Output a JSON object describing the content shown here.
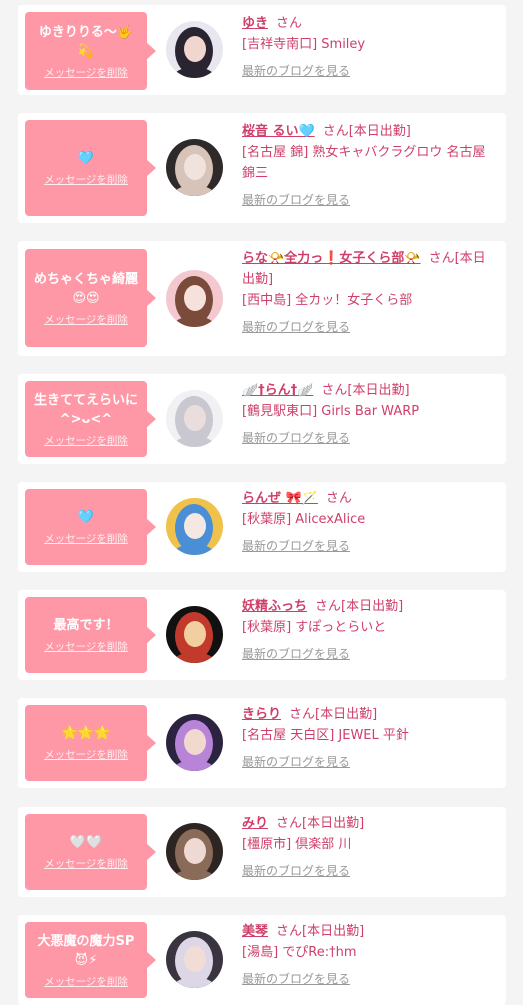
{
  "delete_label": "メッセージを削除",
  "blog_label": "最新のブログを見る",
  "san_label": "さん",
  "colors": {
    "bubble": "#ff98a6",
    "name": "#cf3f6a",
    "link_gray": "#999999",
    "background": "#f4f4f4"
  },
  "cards": [
    {
      "message": "ゆきりりる〜🤟\n💫",
      "name": "ゆき",
      "status": "",
      "shop": "[吉祥寺南口] Smiley",
      "avatar_colors": [
        "#e8e6ef",
        "#2a2430",
        "#f1d6cf"
      ]
    },
    {
      "message": "🩵",
      "name": "桜音 るい🩵",
      "status": "[本日出勤]",
      "shop": "[名古屋 錦] 熟女キャバクラグロウ 名古屋錦三",
      "avatar_colors": [
        "#2e2a2a",
        "#d8c3b8",
        "#f0e2dc"
      ]
    },
    {
      "message": "めちゃくちゃ綺麗\n😍😍",
      "name": "らな📯全力っ❗️女子くら部📯",
      "status": "[本日出勤]",
      "shop": "[西中島] 全カッ！女子くら部",
      "avatar_colors": [
        "#f3c9cf",
        "#7a4b3a",
        "#f7e1dc"
      ]
    },
    {
      "message": "生きててえらいに\n^>ᴗ<^",
      "name": "🪽†らん†🪽",
      "status": "[本日出勤]",
      "shop": "[鶴見駅東口] Girls Bar WARP",
      "avatar_colors": [
        "#f1f1f3",
        "#c9c7cf",
        "#e9dedd"
      ]
    },
    {
      "message": "🩵",
      "name": "らんぜ 🎀🪄",
      "status": "",
      "shop": "[秋葉原] AlicexAlice",
      "avatar_colors": [
        "#f0c14b",
        "#4a8fd6",
        "#f5e7e1"
      ]
    },
    {
      "message": "最高です！",
      "name": "妖精ふっち",
      "status": "[本日出勤]",
      "shop": "[秋葉原] すぽっとらいと",
      "avatar_colors": [
        "#111111",
        "#c23a2b",
        "#f2cfa0"
      ]
    },
    {
      "message": "🌟🌟🌟",
      "name": "きらり",
      "status": "[本日出勤]",
      "shop": "[名古屋 天白区] JEWEL 平針",
      "avatar_colors": [
        "#2b2340",
        "#b784d8",
        "#f1d9cf"
      ]
    },
    {
      "message": "🤍🤍",
      "name": "みり",
      "status": "[本日出勤]",
      "shop": "[橿原市] 倶楽部 川",
      "avatar_colors": [
        "#2c2522",
        "#8a6b5a",
        "#eedad2"
      ]
    },
    {
      "message": "大悪魔の魔力SP\n😈⚡",
      "name": "美琴",
      "status": "[本日出勤]",
      "shop": "[湯島] でぴRe:†hm",
      "avatar_colors": [
        "#3a3340",
        "#dcd6e6",
        "#f1ddd6"
      ]
    }
  ]
}
